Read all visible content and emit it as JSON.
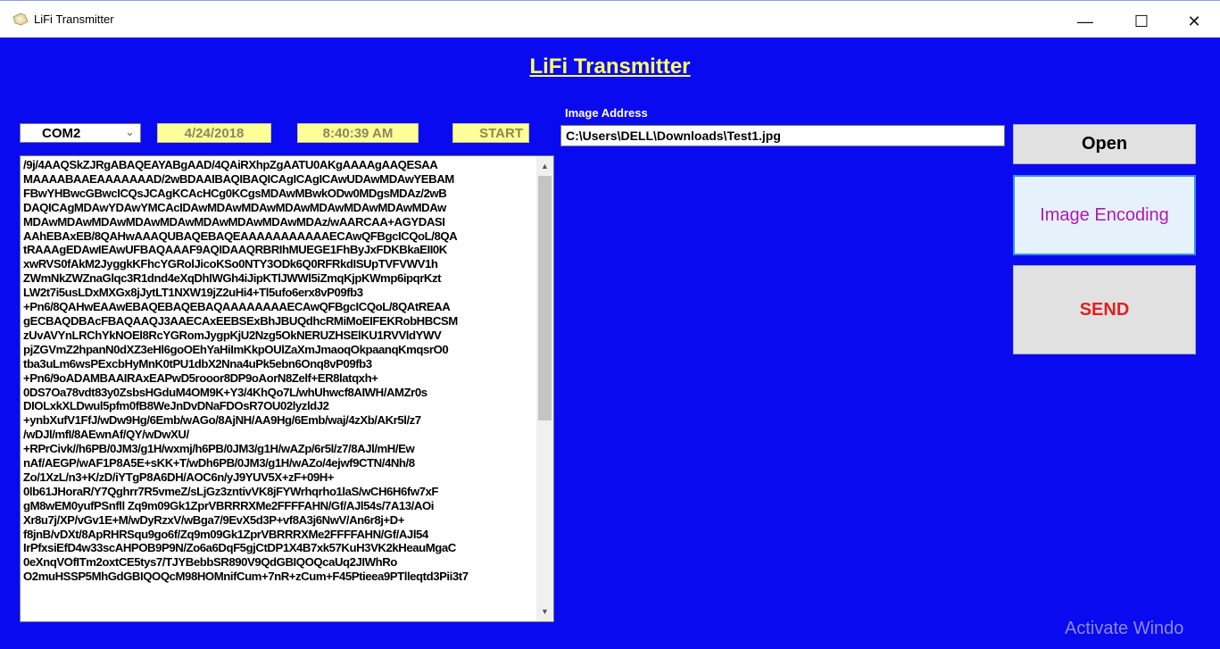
{
  "window": {
    "title": "LiFi Transmitter",
    "controls": {
      "minimize": "—",
      "maximize": "☐",
      "close": "✕"
    }
  },
  "app": {
    "heading": "LiFi Transmitter"
  },
  "port": {
    "selected": "COM2"
  },
  "date": "4/24/2018",
  "time": "8:40:39 AM",
  "start_label": "START",
  "image_address": {
    "label": "Image Address",
    "value": "C:\\Users\\DELL\\Downloads\\Test1.jpg"
  },
  "encoded_text": "/9j/4AAQSkZJRgABAQEAYABgAAD/4QAiRXhpZgAATU0AKgAAAAgAAQESAA\nMAAAABAAEAAAAAAAD/2wBDAAIBAQIBAQICAgICAgICAwUDAwMDAwYEBAM\nFBwYHBwcGBwcICQsJCAgKCAcHCg0KCgsMDAwMBwkODw0MDgsMDAz/2wB\nDAQICAgMDAwYDAwYMCAcIDAwMDAwMDAwMDAwMDAwMDAwMDAwMDAw\nMDAwMDAwMDAwMDAwMDAwMDAwMDAwMDAwMDAz/wAARCAA+AGYDASI\nAAhEBAxEB/8QAHwAAAQUBAQEBAQEAAAAAAAAAAAECAwQFBgcICQoL/8QA\ntRAAAgEDAwIEAwUFBAQAAAF9AQIDAAQRBRIhMUEGE1FhByJxFDKBkaEII0K\nxwRVS0fAkM2JyggkKFhcYGRolJicoKSo0NTY3ODk6Q0RFRkdISUpTVFVWV1h\nZWmNkZWZnaGlqc3R1dnd4eXqDhIWGh4iJipKTlJWWl5iZmqKjpKWmp6ipqrKzt\nLW2t7i5usLDxMXGx8jJytLT1NXW19jZ2uHi4+Tl5ufo6erx8vP09fb3\n+Pn6/8QAHwEAAwEBAQEBAQEBAQAAAAAAAAECAwQFBgcICQoL/8QAtREAA\ngECBAQDBAcFBAQAAQJ3AAECAxEEBSExBhJBUQdhcRMiMoEIFEKRobHBCSM\nzUvAVYnLRChYkNOEl8RcYGRomJygpKjU2Nzg5OkNERUZHSElKU1RVVldYWV\npjZGVmZ2hpanN0dXZ3eHl6goOEhYaHiImKkpOUlZaXmJmaoqOkpaanqKmqsrO0\ntba3uLm6wsPExcbHyMnK0tPU1dbX2Nna4uPk5ebn6Onq8vP09fb3\n+Pn6/9oADAMBAAIRAxEAPwD5rooor8DP9oAorN8Zelf+ER8latqxh+\n0DS7Oa78vdt83y0ZsbsHGduM4OM9K+Y3/4KhQo7L/whUhwcf8AIWH/AMZr0s\nDIOLxkXLDwul5pfm0fB8WeJnDvDNaFDOsR7OU02lyzldJ2\n+ynbXufV1FfJ/wDw9Hg/6Emb/wAGo/8AjNH/AA9Hg/6Emb/waj/4zXb/AKr5l/z7\n/wDJl/mfI/8AEwnAf/QY/wDwXU/\n+RPrCivk//h6PB/0JM3/g1H/wxmj/h6PB/0JM3/g1H/wAZp/6r5l/z7/8AJl/mH/Ew\nnAf/AEGP/wAF1P8A5E+sKK+T/wDh6PB/0JM3/g1H/wAZo/4ejwf9CTN/4Nh/8\nZo/1XzL/n3+K/zD/iYTgP8A6DH/AOC6n/yJ9YUV5X+zF+09H+\n0lb61JHoraR/Y7Qghrr7R5vmeZ/sLjGz3zntivVK8jFYWrhqrho1laS/wCH6H6fw7xF\ngM8wEM0yufPSnfll Zq9m09Gk1ZprVBRRRXMe2FFFFAHN/Gf/AJl54s/7A13/AOi\nXr8u7j/XP/vGv1E+M/wDyRzxV/wBga7/9EvX5d3P+vf8A3j6NwV/An6r8j+D+\nf8jnB/vDXt/8ApRHRSqu9go6f/Zq9m09Gk1ZprVBRRRXMe2FFFFAHN/Gf/AJl54\nIrPfxsiEfD4w33scAHPOB9P9N/Zo6a6DqF5gjCtDP1X4B7xk57KuH3VK2kHeauMgaC\n0eXnqVOfITm2oxtCE5tys7/TJYBebbSR890V9QdGBIQOQcaUq2JIWhRo\nO2muHSSP5MhGdGBIQOQcM98HOMnifCum+7nR+zCum+F45Ptieea9PTlleqtd3Pii3t7"
}
